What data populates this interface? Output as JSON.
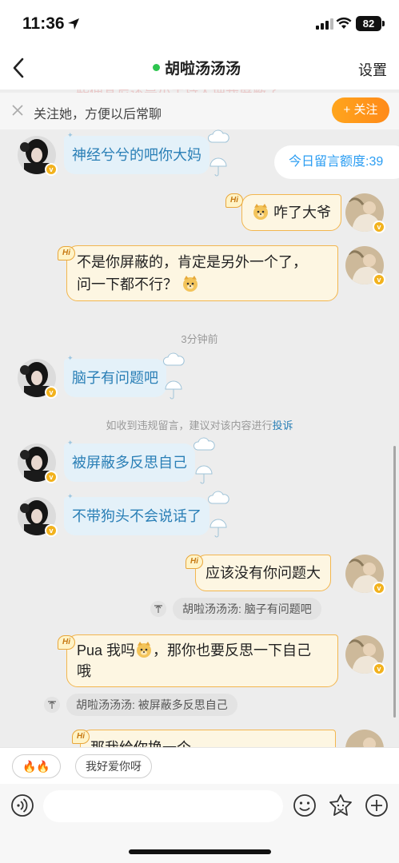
{
  "status": {
    "time": "11:36",
    "battery": "82"
  },
  "nav": {
    "title": "胡啦汤汤汤",
    "settings": "设置"
  },
  "ghost_text": "些便其尼还是小主持人把我屏蔽了",
  "banner": {
    "text": "关注她，方便以后常聊",
    "follow_button": "+ 关注"
  },
  "quota": {
    "text": "今日留言额度:39"
  },
  "messages": {
    "m1": {
      "text": "神经兮兮的吧你大妈"
    },
    "m2": {
      "text": "咋了大爷"
    },
    "m3": {
      "line1": "不是你屏蔽的，肯定是另外一个了，",
      "line2": "问一下都不行？"
    },
    "timestamp": "3分钟前",
    "m4": {
      "text": "脑子有问题吧"
    },
    "notice": {
      "prefix": "如收到违规留言，建议对该内容进行",
      "link": "投诉"
    },
    "m5": {
      "text": "被屏蔽多反思自己"
    },
    "m6": {
      "text": "不带狗头不会说话了"
    },
    "m7": {
      "text": "应该没有你问题大"
    },
    "q1": {
      "text": "胡啦汤汤汤: 脑子有问题吧"
    },
    "m8": {
      "pre": "Pua 我吗",
      "post": "，那你也要反思一下自己",
      "line2": "哦"
    },
    "q2": {
      "text": "胡啦汤汤汤: 被屏蔽多反思自己"
    },
    "m9": {
      "text": "那我给你换一个"
    }
  },
  "hi_label": "Hi",
  "quick_replies": {
    "chip1": "🔥🔥",
    "chip2": "我好爱你呀"
  },
  "input": {
    "placeholder": ""
  },
  "icons": {
    "location": "location-arrow-icon",
    "signal": "signal-icon",
    "wifi": "wifi-icon",
    "back": "chevron-left-icon",
    "close": "close-icon",
    "voice": "voice-icon",
    "emoji": "smiley-icon",
    "sticker": "sticker-icon",
    "plus": "plus-icon",
    "quote": "quote-icon"
  },
  "colors": {
    "accent": "#ff9a1e",
    "link": "#2a7fb6",
    "online": "#2dc54f"
  }
}
